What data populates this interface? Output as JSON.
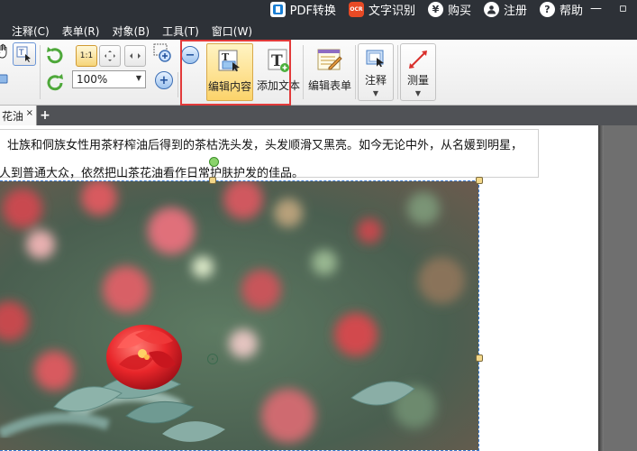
{
  "top_actions": {
    "pdf_convert": "PDF转换",
    "ocr_icon_text": "OCR",
    "ocr": "文字识别",
    "buy": "购买",
    "register": "注册",
    "help": "帮助"
  },
  "menu": {
    "items": [
      "注释(C)",
      "表单(R)",
      "对象(B)",
      "工具(T)",
      "窗口(W)"
    ]
  },
  "toolbar": {
    "zoom_value": "100%",
    "edit_content": "编辑内容",
    "add_text": "添加文本",
    "edit_form": "编辑表单",
    "annotate": "注释",
    "measure": "测量",
    "fit_label": "1:1"
  },
  "tabs": {
    "active_label": "花油",
    "close": "×",
    "add": "+"
  },
  "document": {
    "line1": "壮族和侗族女性用茶籽榨油后得到的茶枯洗头发，头发顺滑又黑亮。如今无论中外，从名媛到明星，",
    "line2": "人到普通大众，依然把山茶花油看作日常护肤护发的佳品。"
  },
  "colors": {
    "topbar": "#2d3137",
    "highlight": "#e23a3a",
    "active_button": "#fcd36a"
  }
}
